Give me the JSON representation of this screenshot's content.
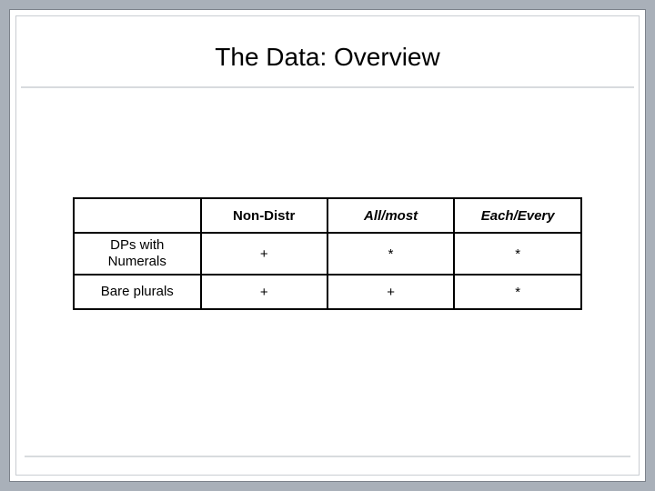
{
  "slide": {
    "title": "The Data: Overview"
  },
  "table": {
    "cols": [
      {
        "label": "Non-Distr",
        "italic": false
      },
      {
        "label": "All/most",
        "italic": true
      },
      {
        "label": "Each/Every",
        "italic": true
      }
    ],
    "rows": [
      {
        "label_line1": "DPs with",
        "label_line2": "Numerals",
        "cells": [
          "+",
          "*",
          "*"
        ]
      },
      {
        "label_line1": "Bare plurals",
        "label_line2": "",
        "cells": [
          "+",
          "+",
          "*"
        ]
      }
    ]
  },
  "chart_data": {
    "type": "table",
    "title": "The Data: Overview",
    "columns": [
      "",
      "Non-Distr",
      "All/most",
      "Each/Every"
    ],
    "rows": [
      [
        "DPs with Numerals",
        "+",
        "*",
        "*"
      ],
      [
        "Bare plurals",
        "+",
        "+",
        "*"
      ]
    ]
  }
}
